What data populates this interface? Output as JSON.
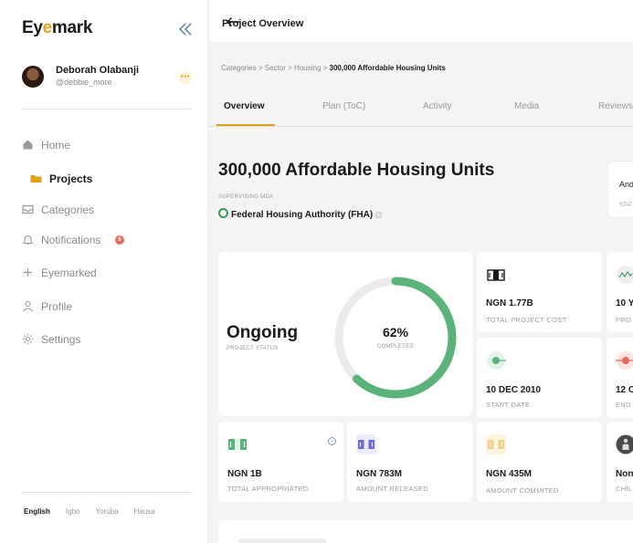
{
  "app": {
    "logo_pre": "Ey",
    "logo_mark": "e",
    "logo_post": "mark"
  },
  "user": {
    "name": "Deborah Olabanji",
    "handle": "@debbie_more",
    "more": "•••"
  },
  "sidebar": {
    "items": [
      {
        "label": "Home",
        "icon": "home-icon"
      },
      {
        "label": "Projects",
        "icon": "folder-icon",
        "active": true
      },
      {
        "label": "Categories",
        "icon": "inbox-icon"
      },
      {
        "label": "Notifications",
        "icon": "bell-icon",
        "badge": "6"
      },
      {
        "label": "Eyemarked",
        "icon": "plus-icon"
      },
      {
        "label": "Profile",
        "icon": "user-icon"
      },
      {
        "label": "Settings",
        "icon": "gear-icon"
      }
    ],
    "languages": [
      "English",
      "Igbo",
      "Yoruba",
      "Hausa"
    ],
    "active_language": "English"
  },
  "header": {
    "title": "Project Overview"
  },
  "breadcrumb": {
    "trail": "Categories > Sector > Housing > ",
    "current": "300,000 Affordable Housing Units"
  },
  "tabs": [
    "Overview",
    "Plan (ToC)",
    "Activity",
    "Media",
    "Reviews"
  ],
  "project": {
    "title": "300,000 Affordable Housing Units",
    "mda_label": "SUPERVISING MDA",
    "mda": "Federal Housing Authority (FHA)",
    "info": "i",
    "side_value": "And",
    "side_label": "STAT"
  },
  "status": {
    "value": "Ongoing",
    "label": "PROJECT STATUS",
    "completed_pct": 62,
    "pct_text": "62%",
    "completed_label": "COMPLETED"
  },
  "stats": {
    "total_cost": {
      "value": "NGN 1.77B",
      "label": "TOTAL PROJECT COST",
      "icon": "money-icon"
    },
    "duration": {
      "value": "10 Y",
      "label": "PRO",
      "icon": "trend-icon"
    },
    "start_date": {
      "value": "10 DEC 2010",
      "label": "START DATE",
      "icon": "start-dot-icon"
    },
    "end_date": {
      "value": "12 O",
      "label": "END",
      "icon": "end-dot-icon"
    },
    "appropriated": {
      "value": "NGN 1B",
      "label": "TOTAL APPROPRIATED",
      "icon": "cash-green-icon",
      "info": "i"
    },
    "released": {
      "value": "NGN 783M",
      "label": "AMOUNT RELEASED",
      "icon": "cash-purple-icon"
    },
    "committed": {
      "value": "NGN 435M",
      "label": "AMOUNT COMMITED",
      "icon": "cash-yellow-icon"
    },
    "children": {
      "value": "Non",
      "label": "CHIL",
      "icon": "people-icon"
    }
  },
  "colors": {
    "accent": "#e0a21c",
    "progress": "#5bb37a",
    "track": "#ebebeb"
  }
}
